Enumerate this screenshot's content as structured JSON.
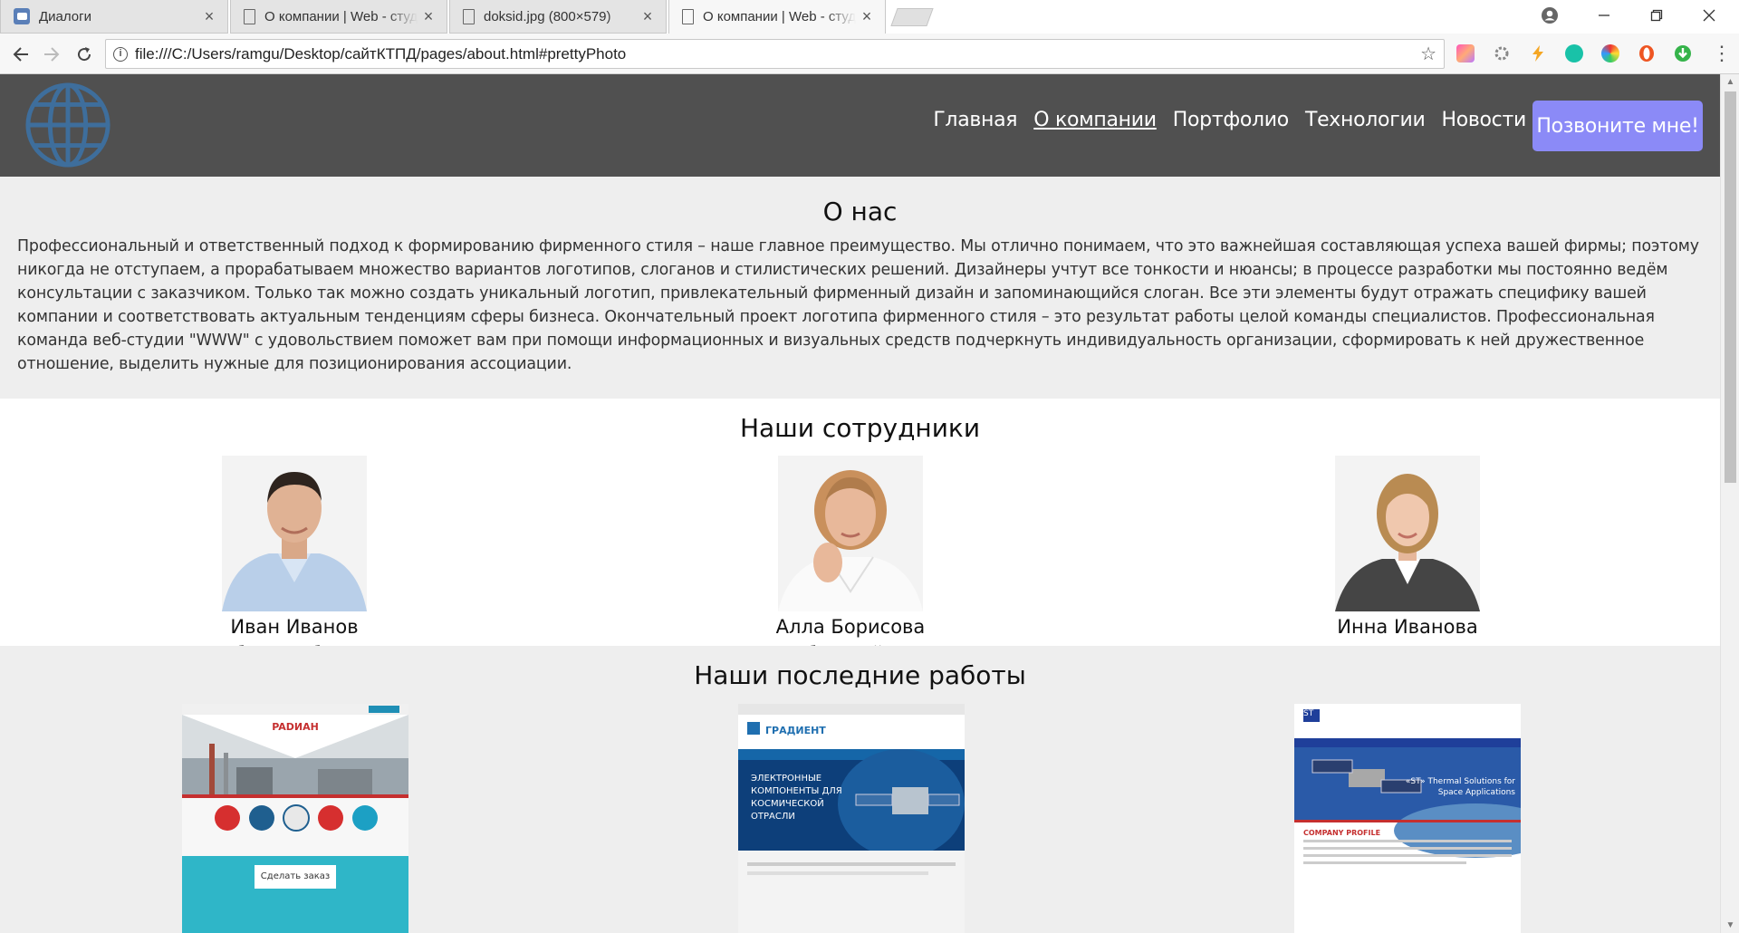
{
  "browser": {
    "tabs": [
      {
        "title": "Диалоги",
        "icon": "chat-icon",
        "active": false
      },
      {
        "title": "О компании | Web - студ",
        "icon": "document-icon",
        "active": false
      },
      {
        "title": "doksid.jpg (800×579)",
        "icon": "document-icon",
        "active": false
      },
      {
        "title": "О компании | Web - студ",
        "icon": "document-icon",
        "active": true
      }
    ],
    "url": "file:///C:/Users/ramgu/Desktop/сайтКТПД/pages/about.html#prettyPhoto"
  },
  "header": {
    "nav": [
      {
        "label": "Главная",
        "current": false
      },
      {
        "label": "О компании",
        "current": true
      },
      {
        "label": "Портфолио",
        "current": false
      },
      {
        "label": "Технологии",
        "current": false
      },
      {
        "label": "Новости",
        "current": false
      }
    ],
    "cta": "Позвоните мне!"
  },
  "about": {
    "title": "О нас",
    "text": "Профессиональный и ответственный подход к формированию фирменного стиля – наше главное преимущество. Мы отлично понимаем, что это важнейшая составляющая успеха вашей фирмы; поэтому никогда не отступаем, а прорабатываем множество вариантов логотипов, слоганов и стилистических решений. Дизайнеры учтут все тонкости и нюансы; в процессе разработки мы постоянно ведём консультации с заказчиком. Только так можно создать уникальный логотип, привлекательный фирменный дизайн и запоминающийся слоган. Все эти элементы будут отражать специфику вашей компании и соответствовать актуальным тенденциям сферы бизнеса. Окончательный проект логотипа фирменного стиля – это результат работы целой команды специалистов. Профессиональная команда веб-студии \"WWW\" с удовольствием поможет вам при помощи информационных и визуальных средств подчеркнуть индивидуальность организации, сформировать к ней дружественное отношение, выделить нужные для позиционирования ассоциации."
  },
  "team": {
    "title": "Наши сотрудники",
    "members": [
      {
        "name": "Иван Иванов",
        "role": "Веб-разработчик"
      },
      {
        "name": "Алла Борисова",
        "role": "Веб-дизайнер"
      },
      {
        "name": "Инна Иванова",
        "role": "Менеджер"
      }
    ]
  },
  "works": {
    "title": "Наши последние работы",
    "items": [
      {
        "brand": "PADИАН",
        "caption": "Сделать заказ"
      },
      {
        "brand": "ГРАДИЕНТ",
        "caption": "ЭЛЕКТРОННЫЕ КОМПОНЕНТЫ ДЛЯ КОСМИЧЕСКОЙ ОТРАСЛИ"
      },
      {
        "brand": "ST",
        "caption": "«ST» Thermal Solutions for Space Applications",
        "sub": "COMPANY PROFILE"
      }
    ]
  }
}
